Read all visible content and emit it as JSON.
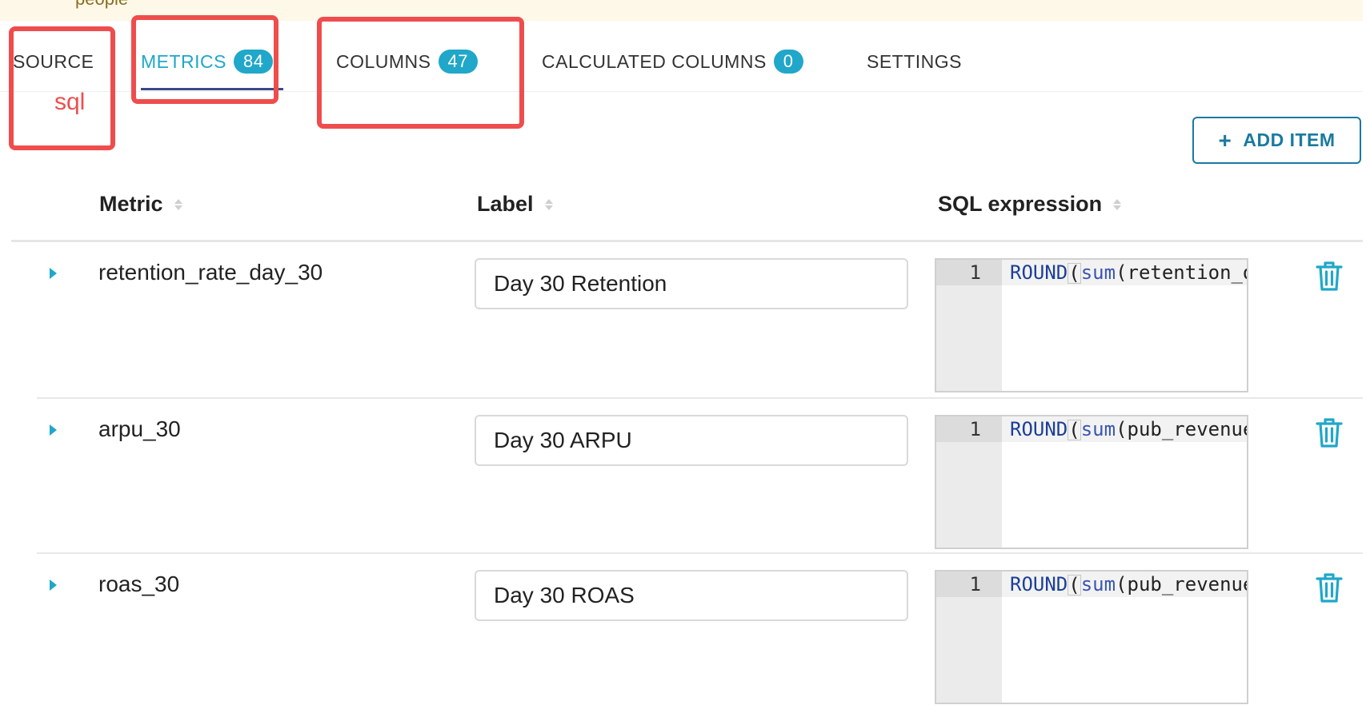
{
  "banner": {
    "text": "people"
  },
  "tabs": [
    {
      "label": "SOURCE",
      "badge": ""
    },
    {
      "label": "METRICS",
      "badge": "84"
    },
    {
      "label": "COLUMNS",
      "badge": "47"
    },
    {
      "label": "CALCULATED COLUMNS",
      "badge": "0"
    },
    {
      "label": "SETTINGS",
      "badge": ""
    }
  ],
  "annotations": {
    "source_note": "sql"
  },
  "toolbar": {
    "add_item_label": "ADD ITEM",
    "add_icon": "plus-icon"
  },
  "table": {
    "headers": {
      "metric": "Metric",
      "label": "Label",
      "sql": "SQL expression"
    },
    "rows": [
      {
        "metric": "retention_rate_day_30",
        "label": "Day 30 Retention",
        "line_no": "1",
        "code": {
          "kw": "ROUND",
          "fn": "sum",
          "rest": "(retention_d"
        }
      },
      {
        "metric": "arpu_30",
        "label": "Day 30 ARPU",
        "line_no": "1",
        "code": {
          "kw": "ROUND",
          "fn": "sum",
          "rest": "(pub_revenue"
        }
      },
      {
        "metric": "roas_30",
        "label": "Day 30 ROAS",
        "line_no": "1",
        "code": {
          "kw": "ROUND",
          "fn": "sum",
          "rest": "(pub_revenue"
        }
      }
    ],
    "row_icons": {
      "expand": "caret-right-icon",
      "delete": "trash-icon"
    }
  },
  "colors": {
    "accent": "#20a7c9",
    "annotation": "#ef4d4d",
    "button": "#1a7aa0"
  }
}
